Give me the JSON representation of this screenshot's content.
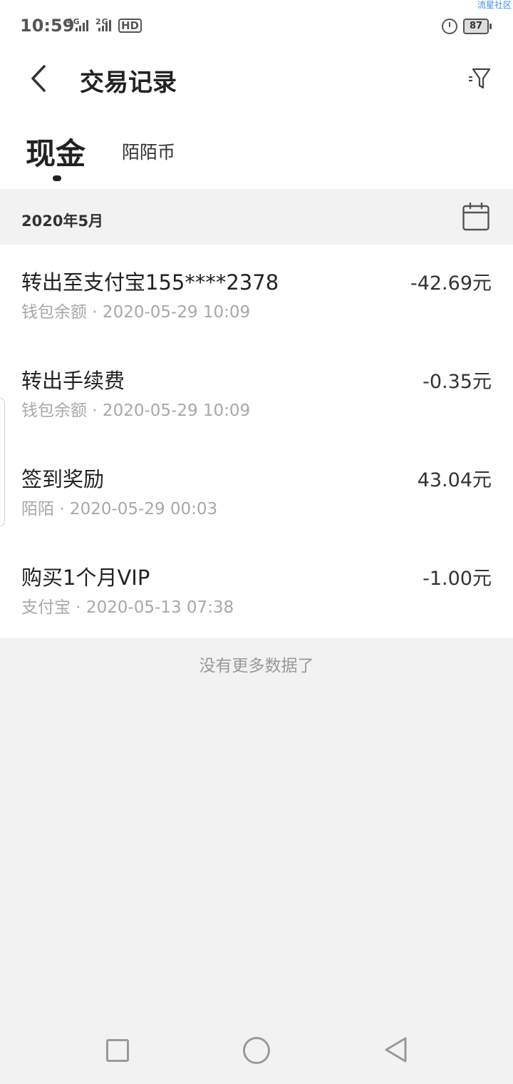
{
  "status_bar": {
    "time": "10:59",
    "network_1": "4G",
    "network_2": "2G",
    "hd": "HD",
    "battery": "87",
    "watermark": "流星社区"
  },
  "header": {
    "title": "交易记录"
  },
  "tabs": [
    {
      "label": "现金",
      "active": true
    },
    {
      "label": "陌陌币",
      "active": false
    }
  ],
  "month": {
    "label": "2020年5月"
  },
  "transactions": [
    {
      "title": "转出至支付宝155****2378",
      "source": "钱包余额 · 2020-05-29 10:09",
      "amount": "-42.69元"
    },
    {
      "title": "转出手续费",
      "source": "钱包余额 · 2020-05-29 10:09",
      "amount": "-0.35元"
    },
    {
      "title": "签到奖励",
      "source": "陌陌 · 2020-05-29 00:03",
      "amount": "43.04元"
    },
    {
      "title": "购买1个月VIP",
      "source": "支付宝 · 2020-05-13 07:38",
      "amount": "-1.00元"
    }
  ],
  "footer": {
    "no_more": "没有更多数据了"
  },
  "colors": {
    "background": "#f2f2f2",
    "card": "#ffffff",
    "secondary_text": "#a8a8a8"
  }
}
